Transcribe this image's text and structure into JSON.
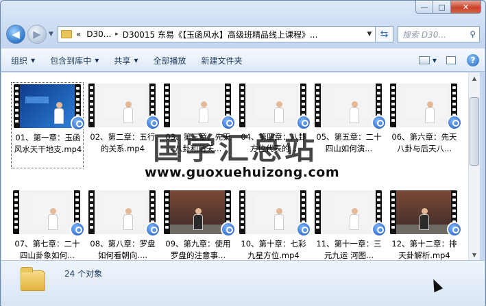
{
  "window": {
    "caption_buttons": {
      "minimize": "—",
      "maximize": "□",
      "close": "✕"
    }
  },
  "address": {
    "chevrons": "«",
    "segments": [
      "D30...",
      "D30015 东易《【玉函风水】高级班精品线上课程》..."
    ],
    "separator": "▸"
  },
  "search": {
    "placeholder": "搜索 D30..."
  },
  "toolbar": {
    "organize": "组织",
    "include_library": "包含到库中",
    "share": "共享",
    "play_all": "全部播放",
    "new_folder": "新建文件夹",
    "help": "?"
  },
  "files": [
    {
      "label": "01、第一章：玉函风水天干地支.mp4",
      "selected": true,
      "theme": "blue"
    },
    {
      "label": "02、第二章：五行的关系.mp4",
      "theme": "white"
    },
    {
      "label": "03、第三章：先天八卦和后天...",
      "theme": "white"
    },
    {
      "label": "04、第四章：八卦方位代表的...",
      "theme": "white"
    },
    {
      "label": "05、第五章：二十四山如何演...",
      "theme": "white"
    },
    {
      "label": "06、第六章：先天八卦与后天八...",
      "theme": "white"
    },
    {
      "label": "07、第七章：二十四山卦象如何...",
      "theme": "white"
    },
    {
      "label": "08、第八章：罗盘如何看朝向....",
      "theme": "white"
    },
    {
      "label": "09、第九章：使用罗盘的注意事...",
      "theme": "stage"
    },
    {
      "label": "10、第十章：七彩九星方位.mp4",
      "theme": "white"
    },
    {
      "label": "11、第十一章：三元九运 河图...",
      "theme": "white"
    },
    {
      "label": "12、第十二章：排天卦解析.mp4",
      "theme": "stage"
    }
  ],
  "watermark": {
    "text": "国学汇总站",
    "url": "www.guoxuehuizong.com"
  },
  "status": {
    "count": "24 个对象"
  },
  "colors": {
    "accent": "#2f78c9",
    "close": "#c8452c"
  }
}
